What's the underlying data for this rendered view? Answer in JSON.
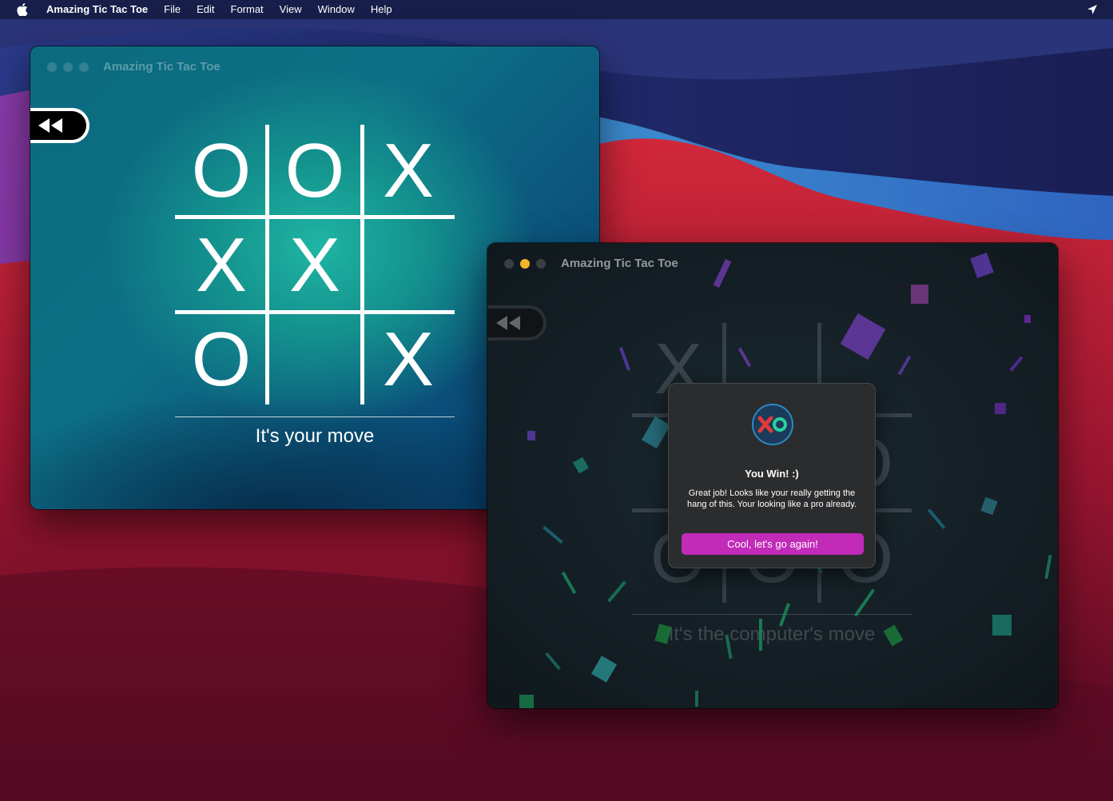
{
  "menubar": {
    "app_name": "Amazing Tic Tac Toe",
    "items": [
      "File",
      "Edit",
      "Format",
      "View",
      "Window",
      "Help"
    ]
  },
  "window1": {
    "title": "Amazing Tic Tac Toe",
    "board": [
      [
        "O",
        "O",
        "X"
      ],
      [
        "X",
        "X",
        ""
      ],
      [
        "O",
        "",
        "X"
      ]
    ],
    "status": "It's your move"
  },
  "window2": {
    "title": "Amazing Tic Tac Toe",
    "board": [
      [
        "X",
        "",
        ""
      ],
      [
        "",
        "",
        "O"
      ],
      [
        "O",
        "O",
        "O"
      ]
    ],
    "status": "It's the computer's move",
    "dialog": {
      "title": "You Win! :)",
      "message": "Great job! Looks like your really getting the hang of this. Your looking like a pro already.",
      "button": "Cool, let's go again!"
    }
  },
  "colors": {
    "accent_button": "#c22ab8",
    "minimize_light": "#f5b52b"
  }
}
